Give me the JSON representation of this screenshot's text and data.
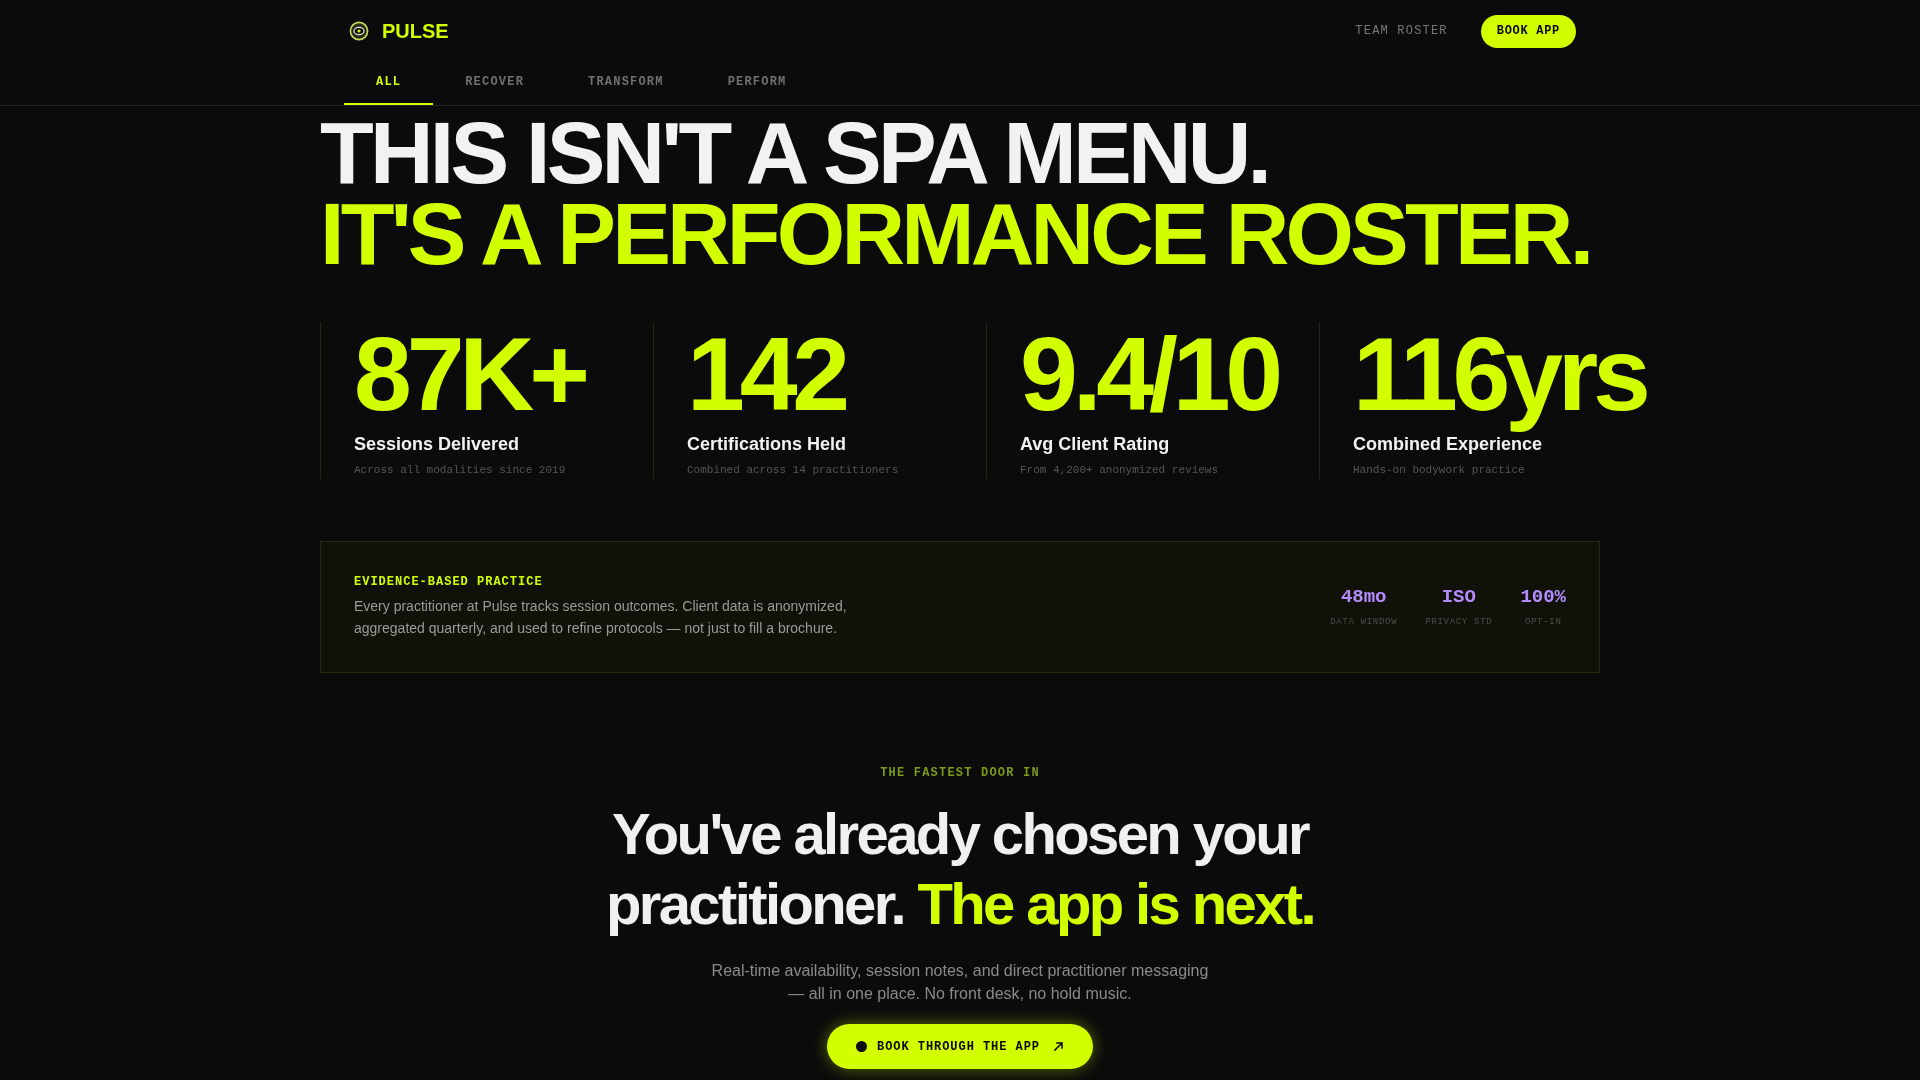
{
  "header": {
    "brand": "PULSE",
    "nav_links": [
      {
        "label": "TEAM ROSTER"
      }
    ],
    "cta": "BOOK APP"
  },
  "tabs": [
    {
      "label": "ALL",
      "selected": true
    },
    {
      "label": "RECOVER",
      "selected": false
    },
    {
      "label": "TRANSFORM",
      "selected": false
    },
    {
      "label": "PERFORM",
      "selected": false
    }
  ],
  "hero": {
    "title": "THIS ISN'T A SPA MENU.",
    "title_accent": "IT'S A PERFORMANCE ROSTER."
  },
  "stats": [
    {
      "value": "87K+",
      "label": "Sessions Delivered",
      "note": "Across all modalities since 2019"
    },
    {
      "value": "142",
      "label": "Certifications Held",
      "note": "Combined across 14 practitioners"
    },
    {
      "value": "9.4/10",
      "label": "Avg Client Rating",
      "note": "From 4,200+ anonymized reviews"
    },
    {
      "value": "116yrs",
      "label": "Combined Experience",
      "note": "Hands-on bodywork practice"
    }
  ],
  "evidence": {
    "label": "EVIDENCE-BASED PRACTICE",
    "text": "Every practitioner at Pulse tracks session outcomes. Client data is anonymized, aggregated quarterly, and used to refine protocols — not just to fill a brochure.",
    "metrics": [
      {
        "value": "48mo",
        "label": "DATA WINDOW"
      },
      {
        "value": "ISO",
        "label": "PRIVACY STD"
      },
      {
        "value": "100%",
        "label": "OPT-IN"
      }
    ]
  },
  "app_section": {
    "eyebrow": "THE FASTEST DOOR IN",
    "heading": "You've already chosen your practitioner. **The app is next.**",
    "text": "Real-time availability, session notes, and direct practitioner messaging — all in one place. No front desk, no hold music."
  },
  "floating_button": {
    "label": "BOOK THROUGH THE APP"
  }
}
